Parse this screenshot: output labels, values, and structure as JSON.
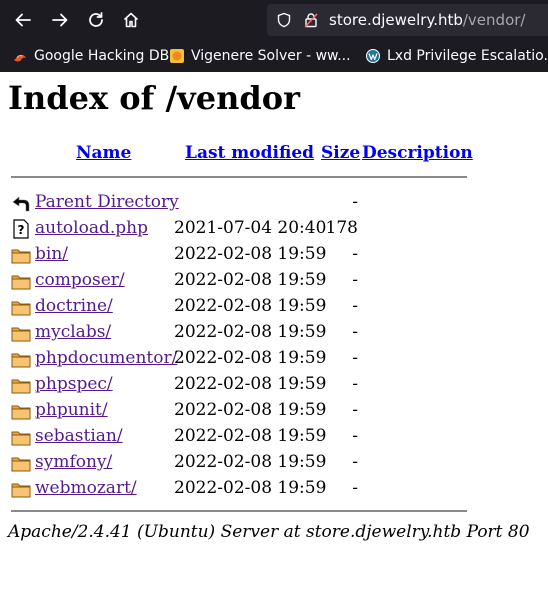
{
  "browser": {
    "url_host": "store.djewelry.htb",
    "url_path": "/vendor/",
    "bookmarks": [
      {
        "label": "Google Hacking DB",
        "icon": "flame-icon"
      },
      {
        "label": "Vigenere Solver - ww...",
        "icon": "coin-icon"
      },
      {
        "label": "Lxd Privilege Escalatio...",
        "icon": "wordpress-icon"
      }
    ]
  },
  "page": {
    "title": "Index of /vendor",
    "columns": {
      "name": "Name",
      "last_modified": "Last modified",
      "size": "Size",
      "description": "Description"
    },
    "entries": [
      {
        "name": "Parent Directory",
        "date": "",
        "size": "-",
        "icon": "back-arrow-icon"
      },
      {
        "name": "autoload.php",
        "date": "2021-07-04 20:40",
        "size": "178",
        "icon": "unknown-file-icon"
      },
      {
        "name": "bin/",
        "date": "2022-02-08 19:59",
        "size": "-",
        "icon": "folder-icon"
      },
      {
        "name": "composer/",
        "date": "2022-02-08 19:59",
        "size": "-",
        "icon": "folder-icon"
      },
      {
        "name": "doctrine/",
        "date": "2022-02-08 19:59",
        "size": "-",
        "icon": "folder-icon"
      },
      {
        "name": "myclabs/",
        "date": "2022-02-08 19:59",
        "size": "-",
        "icon": "folder-icon"
      },
      {
        "name": "phpdocumentor/",
        "date": "2022-02-08 19:59",
        "size": "-",
        "icon": "folder-icon"
      },
      {
        "name": "phpspec/",
        "date": "2022-02-08 19:59",
        "size": "-",
        "icon": "folder-icon"
      },
      {
        "name": "phpunit/",
        "date": "2022-02-08 19:59",
        "size": "-",
        "icon": "folder-icon"
      },
      {
        "name": "sebastian/",
        "date": "2022-02-08 19:59",
        "size": "-",
        "icon": "folder-icon"
      },
      {
        "name": "symfony/",
        "date": "2022-02-08 19:59",
        "size": "-",
        "icon": "folder-icon"
      },
      {
        "name": "webmozart/",
        "date": "2022-02-08 19:59",
        "size": "-",
        "icon": "folder-icon"
      }
    ],
    "footer": "Apache/2.4.41 (Ubuntu) Server at store.djewelry.htb Port 80"
  }
}
